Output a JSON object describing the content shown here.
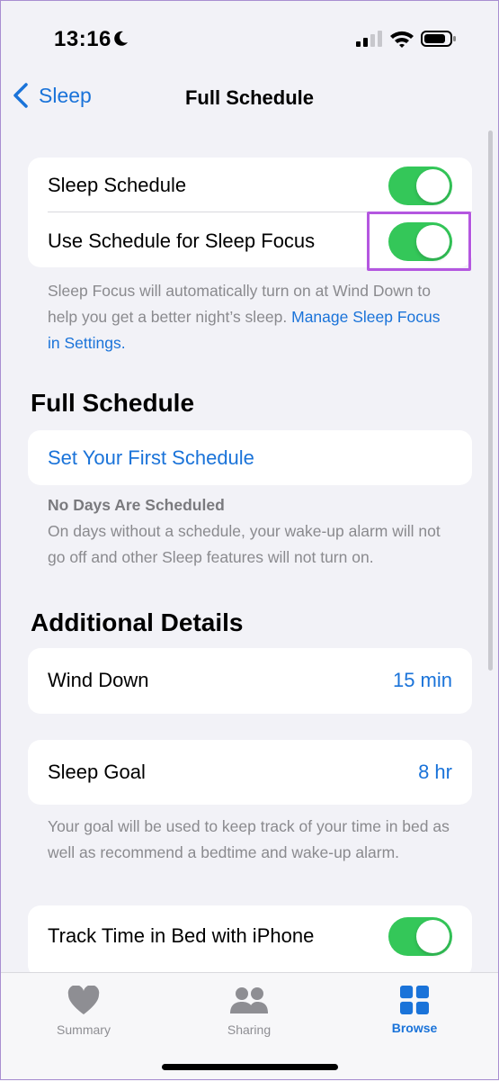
{
  "status_bar": {
    "time": "13:16"
  },
  "nav": {
    "back_label": "Sleep",
    "title": "Full Schedule"
  },
  "settings_card": {
    "sleep_schedule_label": "Sleep Schedule",
    "sleep_schedule_on": true,
    "sleep_focus_label": "Use Schedule for Sleep Focus",
    "sleep_focus_on": true
  },
  "sleep_focus_note": {
    "text": "Sleep Focus will automatically turn on at Wind Down to help you get a better night’s sleep. ",
    "link": "Manage Sleep Focus in Settings."
  },
  "full_schedule": {
    "title": "Full Schedule",
    "set_first_label": "Set Your First Schedule",
    "note_title": "No Days Are Scheduled",
    "note_text": "On days without a schedule, your wake-up alarm will not go off and other Sleep features will not turn on."
  },
  "additional": {
    "title": "Additional Details",
    "wind_down_label": "Wind Down",
    "wind_down_value": "15 min",
    "sleep_goal_label": "Sleep Goal",
    "sleep_goal_value": "8 hr",
    "goal_note": "Your goal will be used to keep track of your time in bed as well as recommend a bedtime and wake-up alarm.",
    "track_label": "Track Time in Bed with iPhone",
    "track_on": true
  },
  "tabbar": {
    "tabs": [
      {
        "label": "Summary",
        "icon": "heart-icon",
        "active": false
      },
      {
        "label": "Sharing",
        "icon": "people-icon",
        "active": false
      },
      {
        "label": "Browse",
        "icon": "grid-icon",
        "active": true
      }
    ]
  },
  "colors": {
    "accent": "#1a73d9",
    "toggle_on": "#34c759",
    "highlight": "#b457e0",
    "background": "#f2f2f7"
  }
}
